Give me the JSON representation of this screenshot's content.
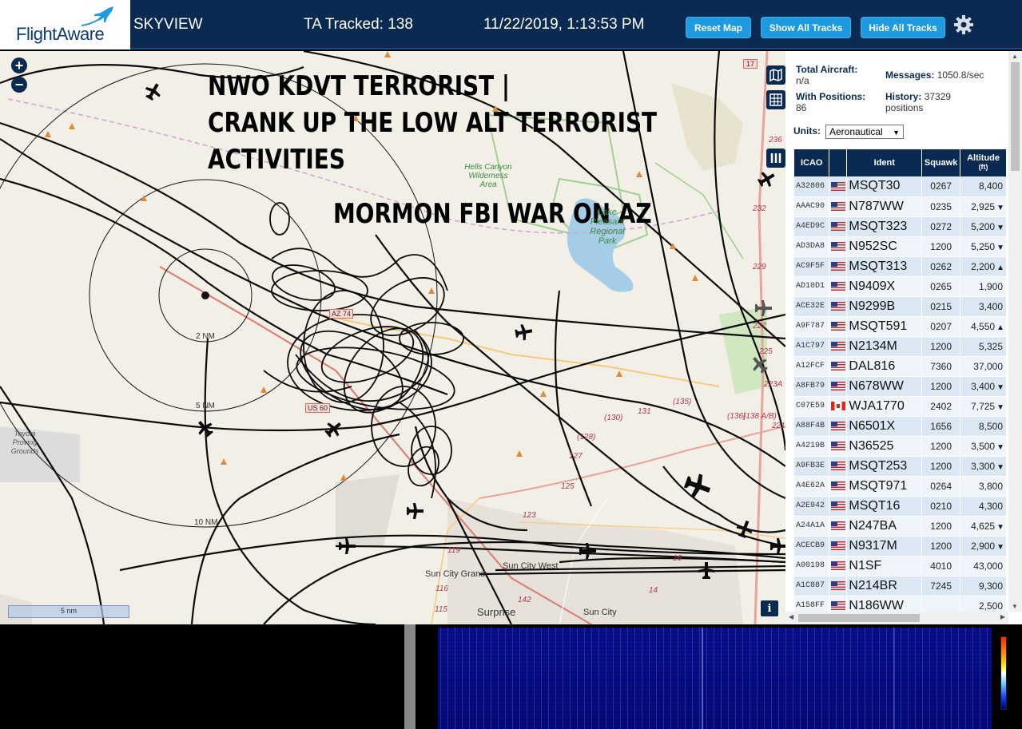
{
  "header": {
    "logo_text": "FlightAware",
    "app_name": "SKYVIEW",
    "ta_tracked": "TA Tracked: 138",
    "datetime": "11/22/2019, 1:13:53 PM",
    "buttons": {
      "reset": "Reset Map",
      "show_all": "Show All Tracks",
      "hide_all": "Hide All Tracks"
    },
    "settings_icon": "gear-icon"
  },
  "overlay": {
    "line1": "NWO KDVT TERRORIST |",
    "line2": "CRANK UP THE LOW ALT TERRORIST",
    "line3": "ACTIVITIES",
    "line4": "MORMON FBI WAR ON AZ"
  },
  "map": {
    "zoom_in": "+",
    "zoom_out": "−",
    "range_labels": {
      "r2": "2 NM",
      "r5": "5 NM",
      "r10": "10 NM"
    },
    "places": {
      "hells_canyon": "Hells Canyon Wilderness Area",
      "lake_pleasant": "Lake Pleasant Regional Park",
      "toyota": "Toyota Proving Grounds",
      "sun_city_grand": "Sun City Grand",
      "sun_city_west": "Sun City West",
      "surprise": "Surprise",
      "sun_city": "Sun City"
    },
    "roads": {
      "az74": "AZ 74",
      "us60": "US 60",
      "i17": "17",
      "r119": "119",
      "r116": "116",
      "r115": "115",
      "r142": "142",
      "r123": "123",
      "r125": "125",
      "r127": "127",
      "r128": "(128)",
      "r130": "(130)",
      "r131": "131",
      "r135": "(135)",
      "r136": "(136)",
      "r138": "(138 A/B)",
      "r221": "221",
      "r223": "223A",
      "r225": "225",
      "r227": "227",
      "r229": "229",
      "r232": "232",
      "r236": "236",
      "r14": "14",
      "r16": "16"
    },
    "scale_label": "5 nm",
    "info_label": "i"
  },
  "sidebar": {
    "total_aircraft_label": "Total Aircraft:",
    "total_aircraft_value": "n/a",
    "messages_label": "Messages:",
    "messages_value": "1050.8/sec",
    "with_positions_label": "With Positions:",
    "with_positions_value": "86",
    "history_label": "History:",
    "history_value": "37329",
    "history_unit": "positions",
    "units_label": "Units:",
    "units_value": "Aeronautical",
    "columns": {
      "icao": "ICAO",
      "ident": "Ident",
      "squawk": "Squawk",
      "altitude": "Altitude",
      "altitude_unit": "(ft)"
    },
    "rows": [
      {
        "icao": "A32806",
        "flag": "us",
        "ident": "MSQT30",
        "squawk": "0267",
        "alt": "8,400",
        "trend": ""
      },
      {
        "icao": "AAAC90",
        "flag": "us",
        "ident": "N787WW",
        "squawk": "0235",
        "alt": "2,925",
        "trend": "▼"
      },
      {
        "icao": "A4ED9C",
        "flag": "us",
        "ident": "MSQT323",
        "squawk": "0272",
        "alt": "5,200",
        "trend": "▼"
      },
      {
        "icao": "AD3DA8",
        "flag": "us",
        "ident": "N952SC",
        "squawk": "1200",
        "alt": "5,250",
        "trend": "▼"
      },
      {
        "icao": "AC9F5F",
        "flag": "us",
        "ident": "MSQT313",
        "squawk": "0262",
        "alt": "2,200",
        "trend": "▲"
      },
      {
        "icao": "AD10D1",
        "flag": "us",
        "ident": "N9409X",
        "squawk": "0265",
        "alt": "1,900",
        "trend": ""
      },
      {
        "icao": "ACE32E",
        "flag": "us",
        "ident": "N9299B",
        "squawk": "0215",
        "alt": "3,400",
        "trend": ""
      },
      {
        "icao": "A9F787",
        "flag": "us",
        "ident": "MSQT591",
        "squawk": "0207",
        "alt": "4,550",
        "trend": "▲"
      },
      {
        "icao": "A1C797",
        "flag": "us",
        "ident": "N2134M",
        "squawk": "1200",
        "alt": "5,325",
        "trend": ""
      },
      {
        "icao": "A12FCF",
        "flag": "us",
        "ident": "DAL816",
        "squawk": "7360",
        "alt": "37,000",
        "trend": ""
      },
      {
        "icao": "A8FB79",
        "flag": "us",
        "ident": "N678WW",
        "squawk": "1200",
        "alt": "3,400",
        "trend": "▼"
      },
      {
        "icao": "C07E59",
        "flag": "ca",
        "ident": "WJA1770",
        "squawk": "2402",
        "alt": "7,725",
        "trend": "▼"
      },
      {
        "icao": "A88F4B",
        "flag": "us",
        "ident": "N6501X",
        "squawk": "1656",
        "alt": "8,500",
        "trend": ""
      },
      {
        "icao": "A4219B",
        "flag": "us",
        "ident": "N36525",
        "squawk": "1200",
        "alt": "3,500",
        "trend": "▼"
      },
      {
        "icao": "A9FB3E",
        "flag": "us",
        "ident": "MSQT253",
        "squawk": "1200",
        "alt": "3,300",
        "trend": "▼"
      },
      {
        "icao": "A4E62A",
        "flag": "us",
        "ident": "MSQT971",
        "squawk": "0264",
        "alt": "3,800",
        "trend": ""
      },
      {
        "icao": "A2E942",
        "flag": "us",
        "ident": "MSQT16",
        "squawk": "0210",
        "alt": "4,300",
        "trend": ""
      },
      {
        "icao": "A24A1A",
        "flag": "us",
        "ident": "N247BA",
        "squawk": "1200",
        "alt": "4,625",
        "trend": "▼"
      },
      {
        "icao": "ACECB9",
        "flag": "us",
        "ident": "N9317M",
        "squawk": "1200",
        "alt": "2,900",
        "trend": "▼"
      },
      {
        "icao": "A00198",
        "flag": "us",
        "ident": "N1SF",
        "squawk": "4010",
        "alt": "43,000",
        "trend": ""
      },
      {
        "icao": "A1C887",
        "flag": "us",
        "ident": "N214BR",
        "squawk": "7245",
        "alt": "9,300",
        "trend": ""
      },
      {
        "icao": "A158FF",
        "flag": "us",
        "ident": "N186WW",
        "squawk": "",
        "alt": "2,500",
        "trend": ""
      }
    ]
  }
}
